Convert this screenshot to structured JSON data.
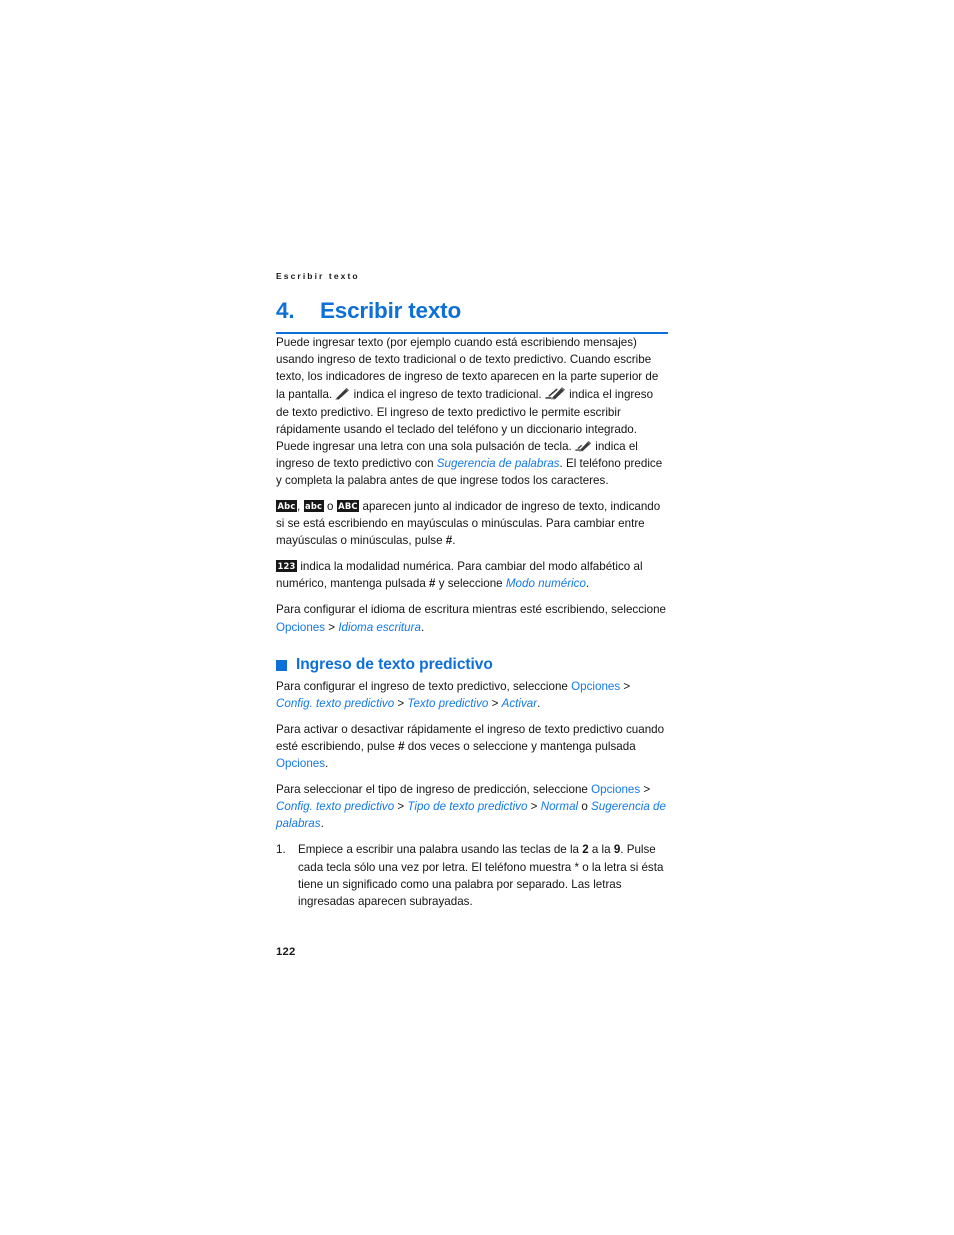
{
  "page": {
    "running_head": "Escribir texto",
    "folio": "122",
    "accent_color": "#0d6fd8",
    "link_color": "#1379e8",
    "badge_bg": "#171717"
  },
  "chapter": {
    "number": "4.",
    "title": "Escribir texto"
  },
  "icons": {
    "pen": "pen-nib-icon",
    "predictive_small": "predictive-text-pen-small-icon",
    "predictive_large": "predictive-text-pen-large-icon"
  },
  "paragraphs": {
    "p1": {
      "t1": "Puede ingresar texto (por ejemplo cuando está escribiendo mensajes) usando ingreso de texto tradicional o de texto predictivo. Cuando escribe texto, los indicadores de ingreso de texto aparecen en la parte superior de la pantalla. ",
      "t2": " indica el ingreso de texto tradicional. ",
      "t3": " indica el ingreso de texto predictivo. El ingreso de texto predictivo le permite escribir rápidamente usando el teclado del teléfono y un diccionario integrado. Puede ingresar una letra con una sola pulsación de tecla. ",
      "t4": " indica el ingreso de texto predictivo con ",
      "link1": "Sugerencia de palabras",
      "t5": ". El teléfono predice y completa la palabra antes de que ingrese todos los caracteres."
    },
    "p2": {
      "badge1": "Abc",
      "sep1": ", ",
      "badge2": "abc",
      "sep2": " o ",
      "badge3": "ABC",
      "t1": " aparecen junto al indicador de ingreso de texto, indicando si se está escribiendo en mayúsculas o minúsculas. Para cambiar entre mayúsculas o minúsculas, pulse ",
      "key": "#",
      "t2": "."
    },
    "p3": {
      "badge": "123",
      "t1": " indica la modalidad numérica. Para cambiar del modo alfabético al numérico, mantenga pulsada ",
      "key": "#",
      "t2": " y seleccione ",
      "link1": "Modo numérico",
      "t3": "."
    },
    "p4": {
      "t1": "Para configurar el idioma de escritura mientras esté escribiendo, seleccione ",
      "link1": "Opciones",
      "t2": " > ",
      "link2": "Idioma escritura",
      "t3": "."
    }
  },
  "section": {
    "heading": "Ingreso de texto predictivo",
    "p1": {
      "t1": "Para configurar el ingreso de texto predictivo, seleccione ",
      "link1": "Opciones",
      "t2": " > ",
      "link2": "Config. texto predictivo",
      "t3": " > ",
      "link3": "Texto predictivo",
      "t4": " > ",
      "link4": "Activar",
      "t5": "."
    },
    "p2": {
      "t1": "Para activar o desactivar rápidamente el ingreso de texto predictivo cuando esté escribiendo, pulse ",
      "key": "#",
      "t2": " dos veces o seleccione y mantenga pulsada ",
      "link1": "Opciones",
      "t3": "."
    },
    "p3": {
      "t1": "Para seleccionar el tipo de ingreso de predicción, seleccione ",
      "link1": "Opciones",
      "t2": " > ",
      "link2": "Config. texto predictivo",
      "t3": " > ",
      "link3": "Tipo de texto predictivo",
      "t4": " > ",
      "link4": "Normal",
      "t5": " o ",
      "link5": "Sugerencia de palabras",
      "t6": "."
    },
    "steps": [
      {
        "marker": "1.",
        "t1": "Empiece a escribir una palabra usando las teclas de la ",
        "key1": "2",
        "t2": " a la ",
        "key2": "9",
        "t3": ". Pulse cada tecla sólo una vez por letra. El teléfono muestra * o la letra si ésta tiene un significado como una palabra por separado. Las letras ingresadas aparecen subrayadas."
      }
    ]
  }
}
